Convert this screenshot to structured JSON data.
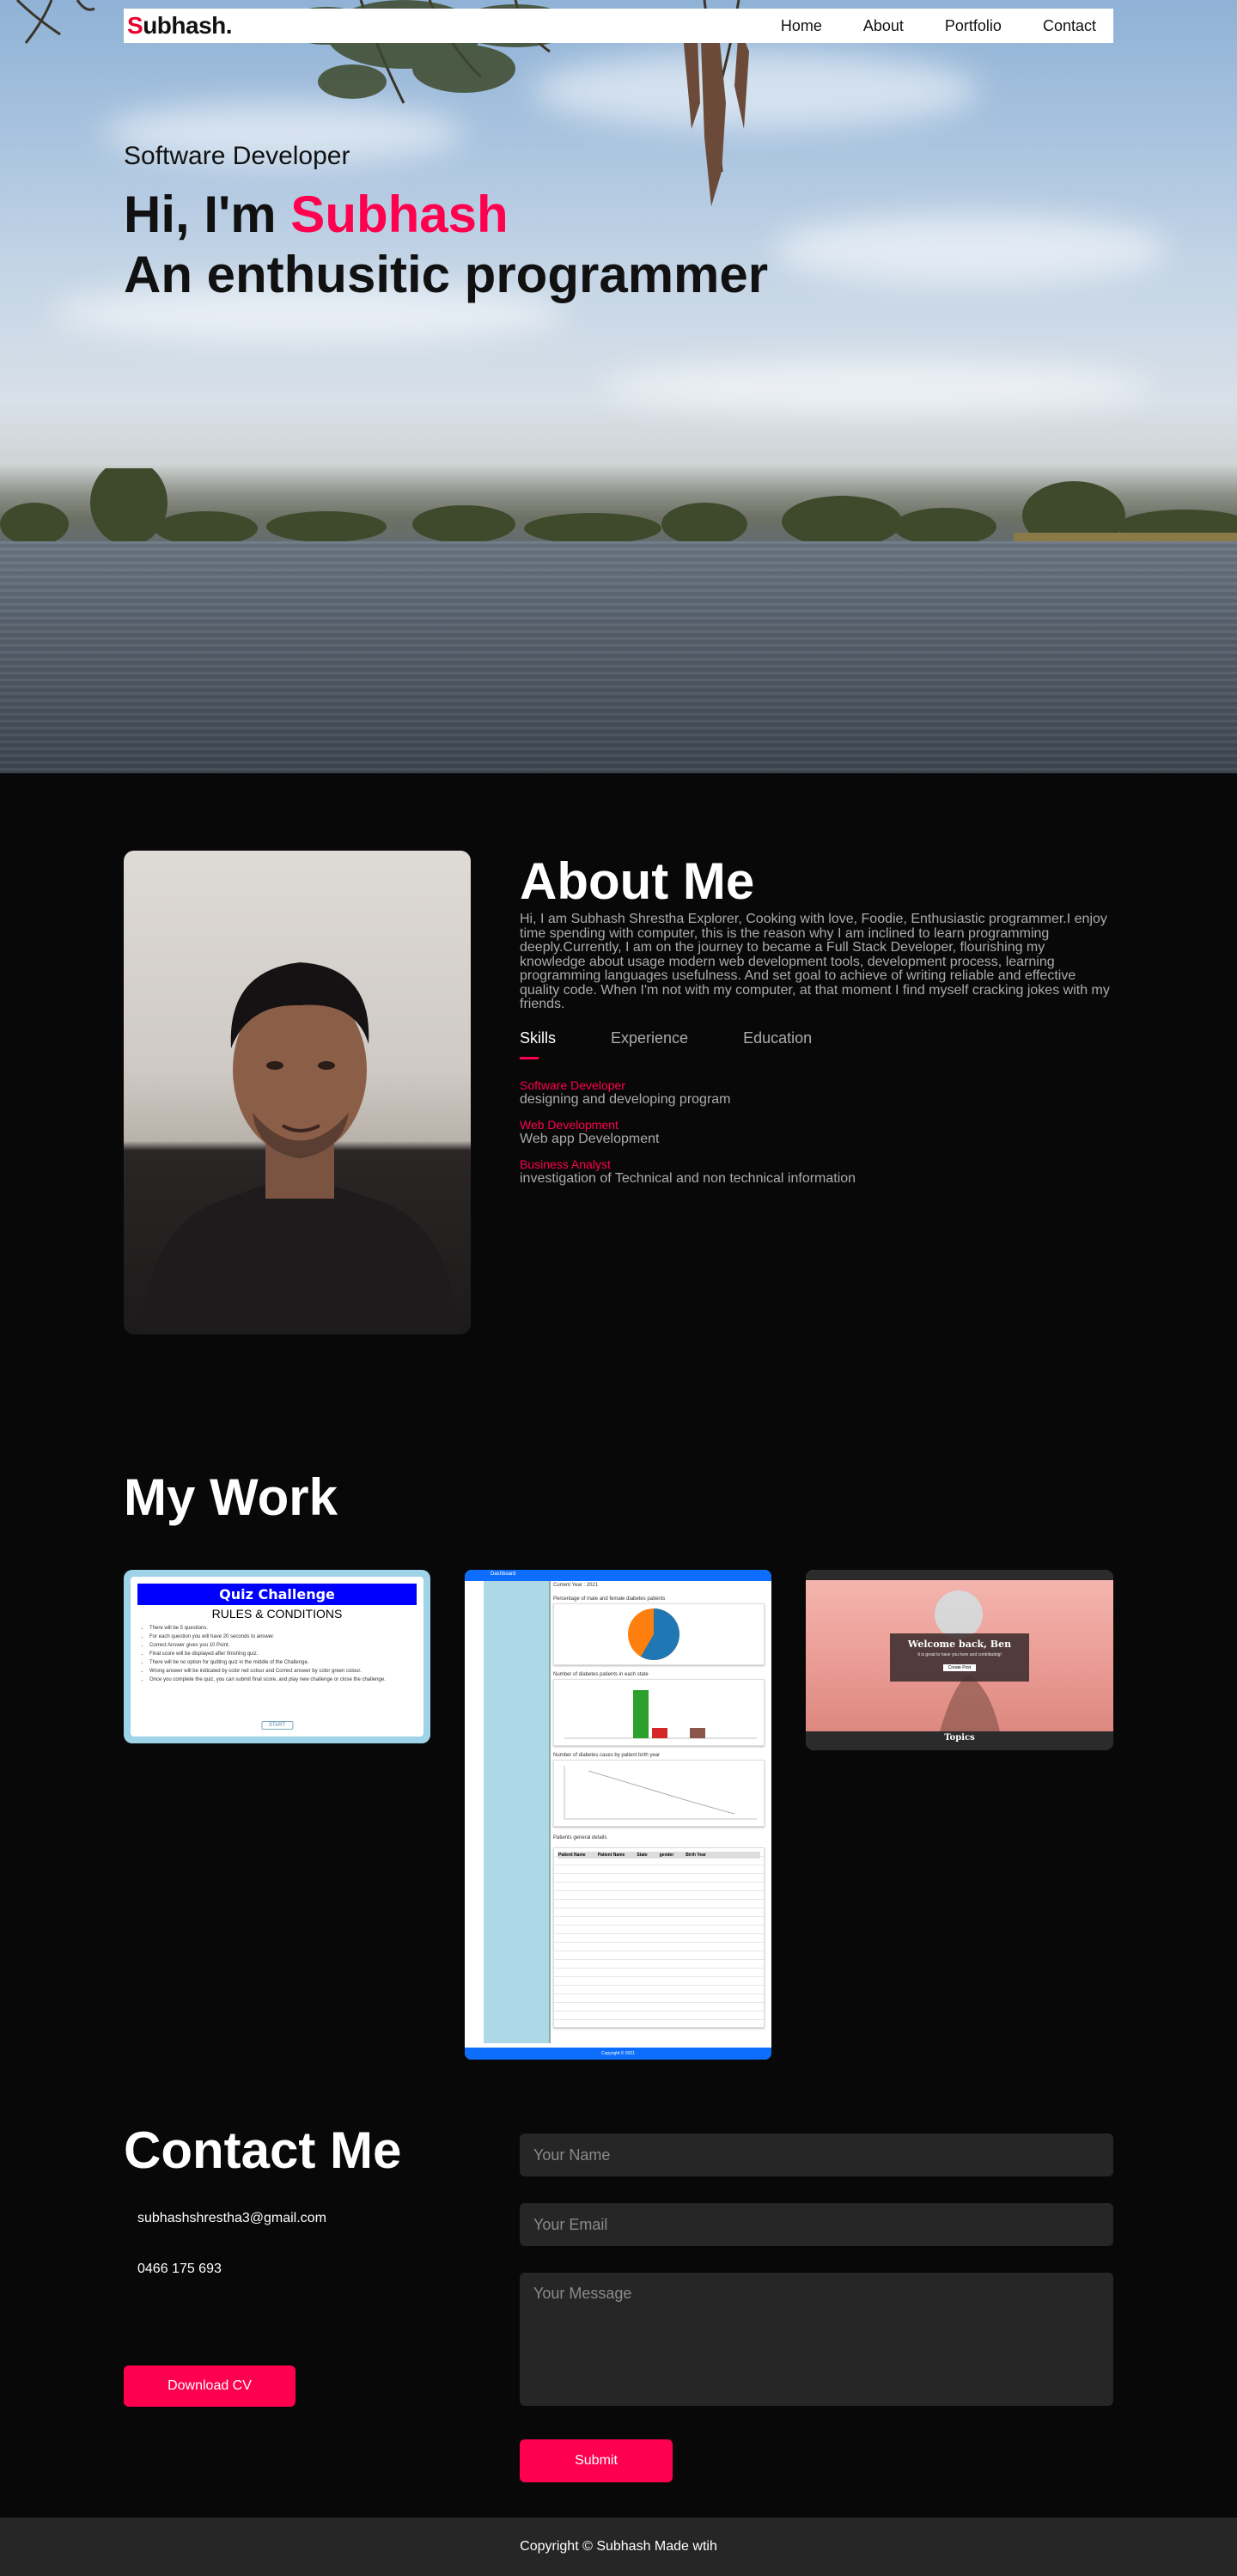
{
  "nav": {
    "logo_first": "S",
    "logo_rest": "ubhash.",
    "links": [
      "Home",
      "About",
      "Portfolio",
      "Contact"
    ]
  },
  "hero": {
    "subtitle": "Software Developer",
    "greeting": "Hi, I'm ",
    "name": "Subhash",
    "tagline": "An enthusitic programmer"
  },
  "about": {
    "heading": "About Me",
    "paragraph": "Hi, I am Subhash Shrestha Explorer, Cooking with love, Foodie, Enthusiastic programmer.I enjoy time spending with computer, this is the reason why I am inclined to learn programming deeply.Currently, I am on the journey to became a Full Stack Developer, flourishing my knowledge about usage modern web development tools, development process, learning programming languages usefulness. And set goal to achieve of writing reliable and effective quality code. When I'm not with my computer, at that moment I find myself cracking jokes with my friends.",
    "tabs": [
      "Skills",
      "Experience",
      "Education"
    ],
    "active_tab": "Skills",
    "skills": [
      {
        "role": "Software Developer",
        "desc": "designing and developing program"
      },
      {
        "role": "Web Development",
        "desc": "Web app Development"
      },
      {
        "role": "Business Analyst",
        "desc": "investigation of Technical and non technical information"
      }
    ]
  },
  "work": {
    "heading": "My Work",
    "quiz": {
      "title": "Quiz Challenge",
      "subtitle": "RULES & CONDITIONS",
      "rules": [
        "There will be 5 questions.",
        "For each question you will have 20 seconds to answer.",
        "Correct Answer gives you 10 Point.",
        "Final score will be displayed after finishing quiz.",
        "There will be no option for quitting quiz in the middle of the Challenge.",
        "Wrong answer will be indicated by color red colour and Correct answer by color green colour.",
        "Once you complete the quiz, you can submit final score, and play new challenge or close the challenge."
      ],
      "start": "START"
    },
    "dashboard": {
      "brand": "Dashboard",
      "year_label": "Current Year : 2021",
      "chart1": "Percentage of male and female diabetes patients",
      "chart2": "Number of diabetes patients in each state",
      "chart3": "Number of diabetes cases by patient birth year",
      "table_title": "Patients general details",
      "table_headers": [
        "Patient Name",
        "Patient Name",
        "State",
        "gender",
        "Birth Year"
      ],
      "footer": "Copyright © 2021"
    },
    "blog": {
      "welcome": "Welcome back, Ben",
      "message": "It is great to have you here and contributing!",
      "cta": "Create Post",
      "topics": "Topics"
    }
  },
  "contact": {
    "heading": "Contact Me",
    "email": "subhashshrestha3@gmail.com",
    "phone": "0466 175 693",
    "download_cv": "Download CV",
    "name_placeholder": "Your Name",
    "email_placeholder": "Your Email",
    "message_placeholder": "Your Message",
    "submit": "Submit"
  },
  "footer": {
    "copyright": "Copyright © Subhash Made wtih"
  },
  "colors": {
    "accent": "#ff004f",
    "background": "#080808",
    "field": "#262626",
    "muted_text": "#ababab"
  }
}
